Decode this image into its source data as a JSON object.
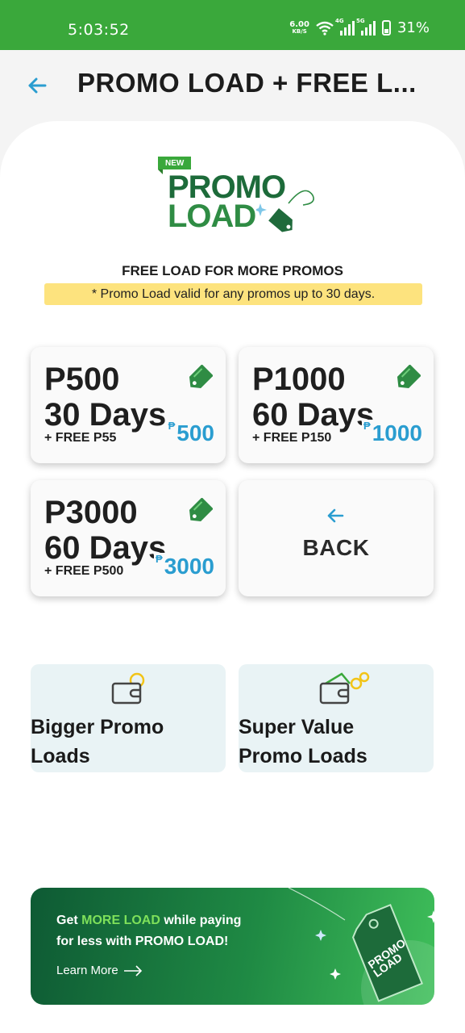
{
  "status_bar": {
    "time": "5:03:52",
    "net_speed": "6.00",
    "net_unit": "KB/S",
    "net_4g": "4G",
    "net_5g": "5G",
    "battery": "31%"
  },
  "header": {
    "title": "PROMO LOAD + FREE L..."
  },
  "logo": {
    "badge": "NEW",
    "line1": "PROMO",
    "line2": "LOAD"
  },
  "intro": {
    "subtitle": "FREE LOAD FOR MORE PROMOS",
    "note": "* Promo Load valid for any promos up to 30 days."
  },
  "offers": [
    {
      "amount": "P500",
      "days": "30 Days",
      "free": "+ FREE P55",
      "currency": "₱",
      "price": "500"
    },
    {
      "amount": "P1000",
      "days": "60 Days",
      "free": "+ FREE P150",
      "currency": "₱",
      "price": "1000"
    },
    {
      "amount": "P3000",
      "days": "60 Days",
      "free": "+ FREE P500",
      "currency": "₱",
      "price": "3000"
    }
  ],
  "back_card": {
    "label": "BACK"
  },
  "categories": [
    {
      "line1": "Bigger Promo",
      "line2": "Loads",
      "icon": "wallet-icon"
    },
    {
      "line1": "Super Value",
      "line2": "Promo Loads",
      "icon": "wallet-cash-icon"
    }
  ],
  "banner": {
    "text_pre": "Get ",
    "text_highlight": "MORE LOAD",
    "text_post": " while paying",
    "line2": "for less with PROMO LOAD!",
    "learn_more": "Learn More",
    "tag_line1": "PROMO",
    "tag_line2": "LOAD"
  },
  "colors": {
    "brand_green": "#3aa83b",
    "accent_blue": "#2a9dd0",
    "note_yellow": "#fde37e",
    "tile_bg": "#e9f3f5"
  }
}
